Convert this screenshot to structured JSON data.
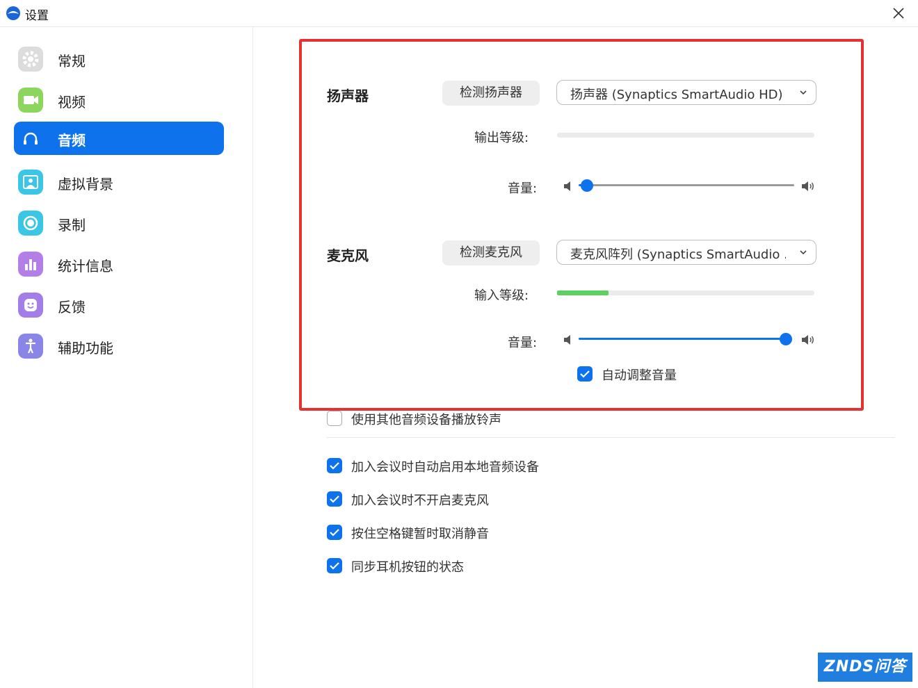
{
  "window": {
    "title": "设置",
    "logo_icon": "zoom-logo-icon",
    "close_icon": "close-icon"
  },
  "sidebar": {
    "items": [
      {
        "label": "常规",
        "icon": "gear-icon",
        "color": "#d9d9d9"
      },
      {
        "label": "视频",
        "icon": "video-camera-icon",
        "color": "#8cd65e"
      },
      {
        "label": "音频",
        "icon": "headphones-icon",
        "color": "#0e72ed",
        "active": true
      },
      {
        "label": "虚拟背景",
        "icon": "virtual-background-icon",
        "color": "#3cc6e6"
      },
      {
        "label": "录制",
        "icon": "record-icon",
        "color": "#3cc6e6"
      },
      {
        "label": "统计信息",
        "icon": "statistics-icon",
        "color": "#b37fe6"
      },
      {
        "label": "反馈",
        "icon": "feedback-smile-icon",
        "color": "#a37ee8"
      },
      {
        "label": "辅助功能",
        "icon": "accessibility-icon",
        "color": "#8a86e8"
      }
    ]
  },
  "speaker": {
    "title": "扬声器",
    "test_button": "检测扬声器",
    "device": "扬声器 (Synaptics SmartAudio HD)",
    "output_level_label": "输出等级:",
    "output_level": 0,
    "volume_label": "音量:",
    "volume": 0.04
  },
  "microphone": {
    "title": "麦克风",
    "test_button": "检测麦克风",
    "device": "麦克风阵列 (Synaptics SmartAudio ...",
    "input_level_label": "输入等级:",
    "input_level": 0.2,
    "volume_label": "音量:",
    "volume": 1.0,
    "auto_adjust_label": "自动调整音量",
    "auto_adjust": true
  },
  "options": {
    "other_ringtone": {
      "label": "使用其他音频设备播放铃声",
      "checked": false
    },
    "auto_join_audio": {
      "label": "加入会议时自动启用本地音频设备",
      "checked": true
    },
    "mute_mic_on_join": {
      "label": "加入会议时不开启麦克风",
      "checked": true
    },
    "space_unmute": {
      "label": "按住空格键暂时取消静音",
      "checked": true
    },
    "sync_headset": {
      "label": "同步耳机按钮的状态",
      "checked": true
    }
  },
  "colors": {
    "accent": "#0e72ed",
    "highlight_border": "#e23232",
    "level_green": "#5cd15f"
  },
  "watermark": {
    "text": "ZNDS问答"
  }
}
